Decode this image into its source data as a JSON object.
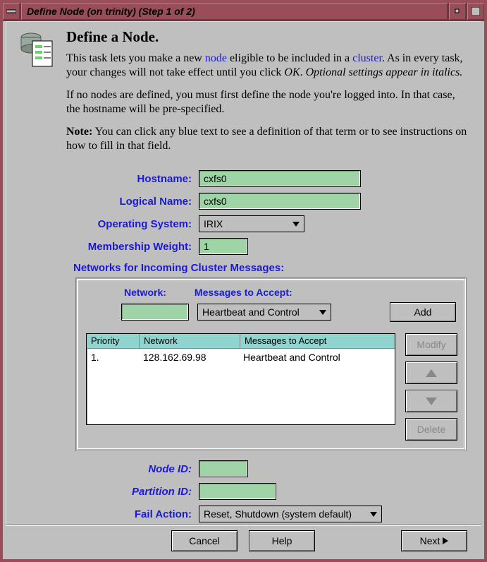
{
  "window": {
    "title": "Define Node (on trinity) (Step 1 of 2)"
  },
  "intro": {
    "heading": "Define a Node.",
    "p1_a": "This task lets you make a new ",
    "p1_link1": "node",
    "p1_b": " eligible to be included in a ",
    "p1_link2": "cluster",
    "p1_c": ".  As in every task, your changes will not take effect until you click ",
    "p1_ok": "OK",
    "p1_d": ".  ",
    "p1_optional": "Optional settings appear in italics.",
    "p2": "If no nodes are defined, you must first define the node you're logged into.  In that case, the hostname will be pre-specified.",
    "p3_bold": "Note:",
    "p3_rest": " You can click any blue text to see a definition of that term or to see instructions on how to fill in that field."
  },
  "labels": {
    "hostname": "Hostname:",
    "logical_name": "Logical Name:",
    "os": "Operating System:",
    "weight": "Membership Weight:",
    "networks_section": "Networks for Incoming Cluster Messages:",
    "network": "Network:",
    "messages": "Messages to Accept:",
    "node_id": "Node ID:",
    "partition_id": "Partition ID:",
    "fail_action": "Fail Action:"
  },
  "fields": {
    "hostname": "cxfs0",
    "logical_name": "cxfs0",
    "os": "IRIX",
    "weight": "1",
    "network_new": "",
    "messages_new": "Heartbeat and Control",
    "node_id": "",
    "partition_id": "",
    "fail_action": "Reset, Shutdown (system default)"
  },
  "table": {
    "headers": {
      "priority": "Priority",
      "network": "Network",
      "messages": "Messages to Accept"
    },
    "rows": [
      {
        "priority": "1.",
        "network": "128.162.69.98",
        "messages": "Heartbeat and Control"
      }
    ]
  },
  "buttons": {
    "add": "Add",
    "modify": "Modify",
    "delete": "Delete",
    "cancel": "Cancel",
    "help": "Help",
    "next": "Next"
  }
}
